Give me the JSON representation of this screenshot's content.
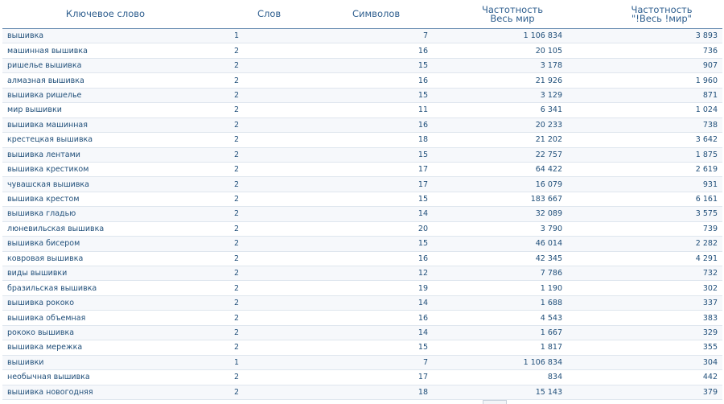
{
  "headers": {
    "keyword": "Ключевое слово",
    "words": "Слов",
    "symbols": "Символов",
    "freq_world_1": "Частотность",
    "freq_world_2": "Весь мир",
    "freq_exact_1": "Частотность",
    "freq_exact_2": "\"!Весь !мир\""
  },
  "rows": [
    {
      "keyword": "вышивка",
      "words": "1",
      "symbols": "7",
      "freq": "1 106 834",
      "exact": "3 893"
    },
    {
      "keyword": "машинная вышивка",
      "words": "2",
      "symbols": "16",
      "freq": "20 105",
      "exact": "736"
    },
    {
      "keyword": "ришелье вышивка",
      "words": "2",
      "symbols": "15",
      "freq": "3 178",
      "exact": "907"
    },
    {
      "keyword": "алмазная вышивка",
      "words": "2",
      "symbols": "16",
      "freq": "21 926",
      "exact": "1 960"
    },
    {
      "keyword": "вышивка ришелье",
      "words": "2",
      "symbols": "15",
      "freq": "3 129",
      "exact": "871"
    },
    {
      "keyword": "мир вышивки",
      "words": "2",
      "symbols": "11",
      "freq": "6 341",
      "exact": "1 024"
    },
    {
      "keyword": "вышивка машинная",
      "words": "2",
      "symbols": "16",
      "freq": "20 233",
      "exact": "738"
    },
    {
      "keyword": "крестецкая вышивка",
      "words": "2",
      "symbols": "18",
      "freq": "21 202",
      "exact": "3 642"
    },
    {
      "keyword": "вышивка лентами",
      "words": "2",
      "symbols": "15",
      "freq": "22 757",
      "exact": "1 875"
    },
    {
      "keyword": "вышивка крестиком",
      "words": "2",
      "symbols": "17",
      "freq": "64 422",
      "exact": "2 619"
    },
    {
      "keyword": "чувашская вышивка",
      "words": "2",
      "symbols": "17",
      "freq": "16 079",
      "exact": "931"
    },
    {
      "keyword": "вышивка крестом",
      "words": "2",
      "symbols": "15",
      "freq": "183 667",
      "exact": "6 161"
    },
    {
      "keyword": "вышивка гладью",
      "words": "2",
      "symbols": "14",
      "freq": "32 089",
      "exact": "3 575"
    },
    {
      "keyword": "люневильская вышивка",
      "words": "2",
      "symbols": "20",
      "freq": "3 790",
      "exact": "739"
    },
    {
      "keyword": "вышивка бисером",
      "words": "2",
      "symbols": "15",
      "freq": "46 014",
      "exact": "2 282"
    },
    {
      "keyword": "ковровая вышивка",
      "words": "2",
      "symbols": "16",
      "freq": "42 345",
      "exact": "4 291"
    },
    {
      "keyword": "виды вышивки",
      "words": "2",
      "symbols": "12",
      "freq": "7 786",
      "exact": "732"
    },
    {
      "keyword": "бразильская вышивка",
      "words": "2",
      "symbols": "19",
      "freq": "1 190",
      "exact": "302"
    },
    {
      "keyword": "вышивка рококо",
      "words": "2",
      "symbols": "14",
      "freq": "1 688",
      "exact": "337"
    },
    {
      "keyword": "вышивка объемная",
      "words": "2",
      "symbols": "16",
      "freq": "4 543",
      "exact": "383"
    },
    {
      "keyword": "рококо вышивка",
      "words": "2",
      "symbols": "14",
      "freq": "1 667",
      "exact": "329"
    },
    {
      "keyword": "вышивка мережка",
      "words": "2",
      "symbols": "15",
      "freq": "1 817",
      "exact": "355"
    },
    {
      "keyword": "вышивки",
      "words": "1",
      "symbols": "7",
      "freq": "1 106 834",
      "exact": "304"
    },
    {
      "keyword": "необычная вышивка",
      "words": "2",
      "symbols": "17",
      "freq": "834",
      "exact": "442"
    },
    {
      "keyword": "вышивка новогодняя",
      "words": "2",
      "symbols": "18",
      "freq": "15 143",
      "exact": "379"
    }
  ]
}
